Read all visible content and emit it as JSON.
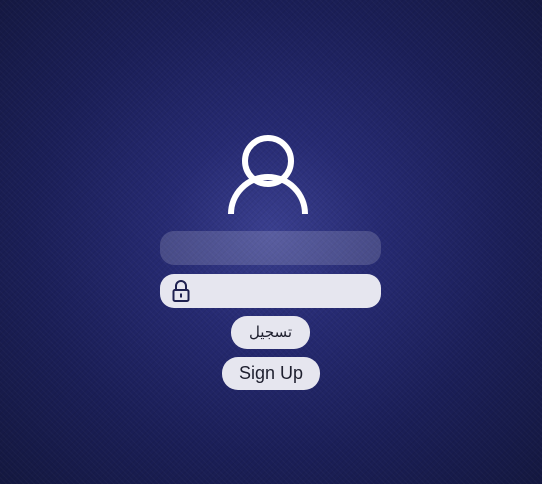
{
  "login_form": {
    "username_field": {
      "value": "",
      "placeholder": ""
    },
    "password_field": {
      "value": "",
      "placeholder": ""
    },
    "login_button_label": "تسجيل",
    "signup_button_label": "Sign Up"
  },
  "icons": {
    "avatar": "user-icon",
    "password": "lock-icon"
  },
  "colors": {
    "background_center": "#3a3f8f",
    "background_edge": "#141840",
    "field_fill": "#e6e6ef",
    "icon_stroke": "#ffffff"
  }
}
